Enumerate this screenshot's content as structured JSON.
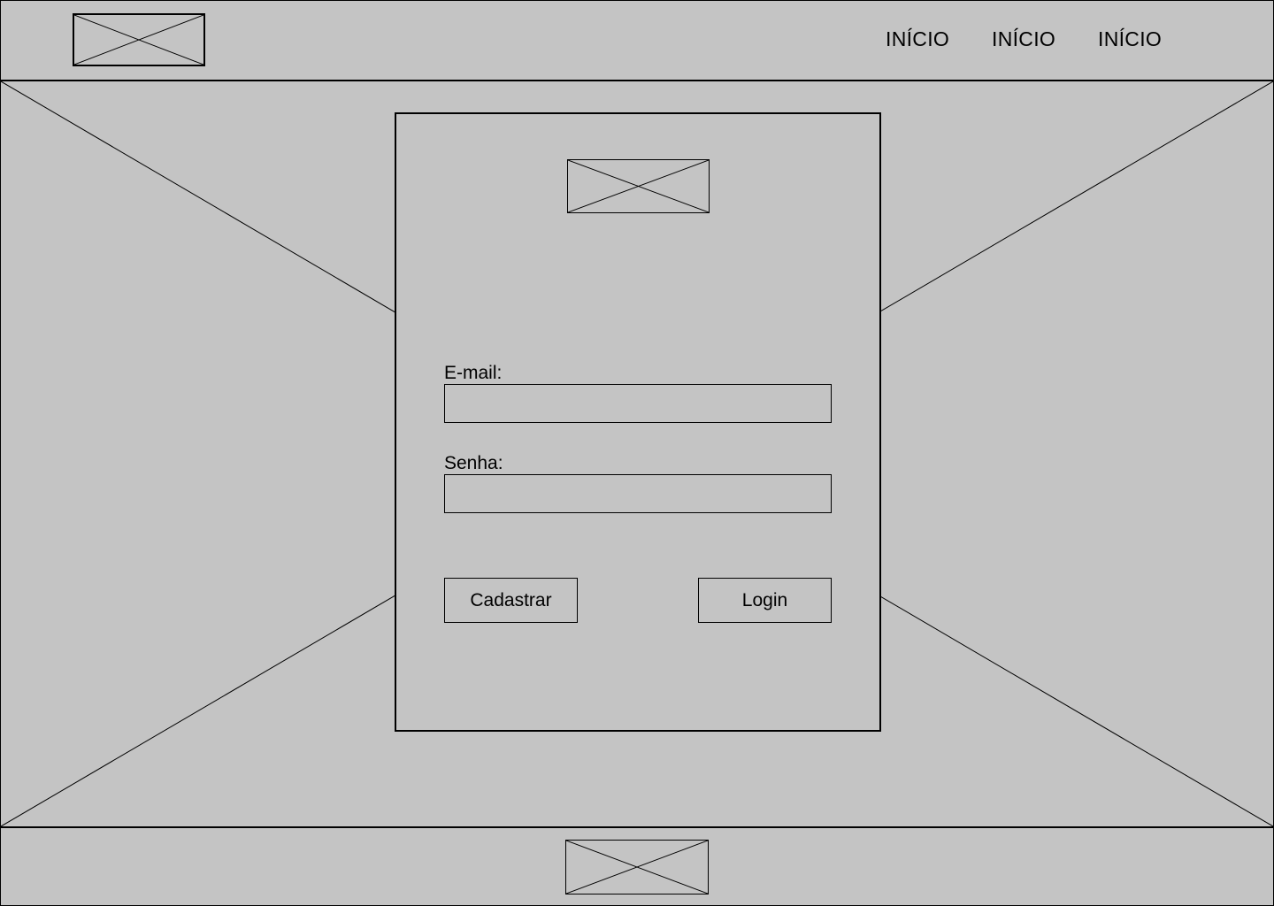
{
  "header": {
    "logo_icon": "image-placeholder-icon",
    "nav": [
      {
        "label": "INÍCIO"
      },
      {
        "label": "INÍCIO"
      },
      {
        "label": "INÍCIO"
      }
    ]
  },
  "hero": {
    "background_icon": "image-placeholder-icon"
  },
  "login_card": {
    "logo_icon": "image-placeholder-icon",
    "email": {
      "label": "E-mail:",
      "value": "",
      "placeholder": ""
    },
    "password": {
      "label": "Senha:",
      "value": "",
      "placeholder": ""
    },
    "register_button_label": "Cadastrar",
    "login_button_label": "Login"
  },
  "footer": {
    "logo_icon": "image-placeholder-icon"
  },
  "colors": {
    "background": "#c4c4c4",
    "stroke": "#000000"
  }
}
